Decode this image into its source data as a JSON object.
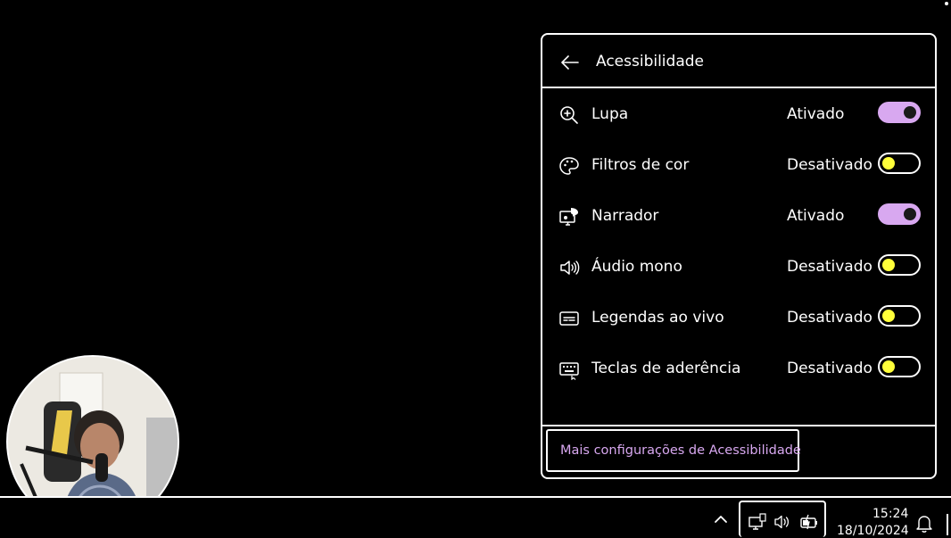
{
  "panel": {
    "title": "Acessibilidade",
    "items": [
      {
        "label": "Lupa",
        "status": "Ativado",
        "on": true,
        "icon": "magnifier-icon"
      },
      {
        "label": "Filtros de cor",
        "status": "Desativado",
        "on": false,
        "icon": "palette-icon"
      },
      {
        "label": "Narrador",
        "status": "Ativado",
        "on": true,
        "icon": "narrator-icon"
      },
      {
        "label": "Áudio mono",
        "status": "Desativado",
        "on": false,
        "icon": "mono-audio-icon"
      },
      {
        "label": "Legendas ao vivo",
        "status": "Desativado",
        "on": false,
        "icon": "live-captions-icon"
      },
      {
        "label": "Teclas de aderência",
        "status": "Desativado",
        "on": false,
        "icon": "sticky-keys-icon"
      }
    ],
    "more_link": "Mais configurações de Acessibilidade"
  },
  "taskbar": {
    "time": "15:24",
    "date": "18/10/2024",
    "tray_icons": [
      "network-icon",
      "volume-icon",
      "battery-icon"
    ]
  },
  "colors": {
    "accent": "#d8a8f0",
    "toggle_off_knob": "#ffff3a",
    "background": "#000000",
    "border": "#ffffff"
  }
}
